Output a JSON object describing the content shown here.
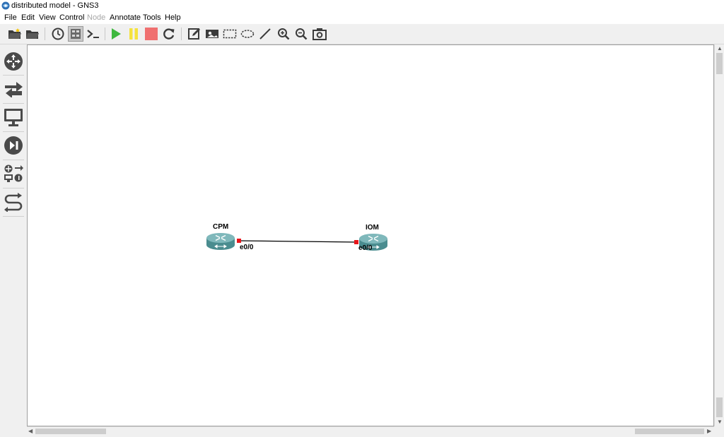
{
  "window": {
    "title": "distributed model - GNS3"
  },
  "menu": {
    "items": [
      {
        "label": "File",
        "enabled": true
      },
      {
        "label": "Edit",
        "enabled": true
      },
      {
        "label": "View",
        "enabled": true
      },
      {
        "label": "Control",
        "enabled": true
      },
      {
        "label": "Node",
        "enabled": false
      },
      {
        "label": "Annotate",
        "enabled": true
      },
      {
        "label": "Tools",
        "enabled": true
      },
      {
        "label": "Help",
        "enabled": true
      }
    ]
  },
  "toolbar": {
    "icons": [
      "new-project-icon",
      "open-project-icon",
      "snapshot-icon",
      "show-interface-labels-icon",
      "console-all-icon",
      "start-all-icon",
      "suspend-all-icon",
      "stop-all-icon",
      "reload-all-icon",
      "add-note-icon",
      "insert-image-icon",
      "draw-rectangle-icon",
      "draw-ellipse-icon",
      "draw-line-icon",
      "zoom-in-icon",
      "zoom-out-icon",
      "screenshot-icon"
    ],
    "active": "show-interface-labels-icon"
  },
  "sidebar": {
    "icons": [
      "routers-icon",
      "switches-icon",
      "end-devices-icon",
      "security-devices-icon",
      "all-devices-icon",
      "add-link-icon"
    ]
  },
  "topology": {
    "nodes": [
      {
        "name": "CPM",
        "port": "e0/0"
      },
      {
        "name": "IOM",
        "port": "e0/0"
      }
    ],
    "colors": {
      "router_body": "#4a8c8f",
      "router_top": "#7fb8bb",
      "port": "#e8141a",
      "link": "#000000"
    }
  }
}
